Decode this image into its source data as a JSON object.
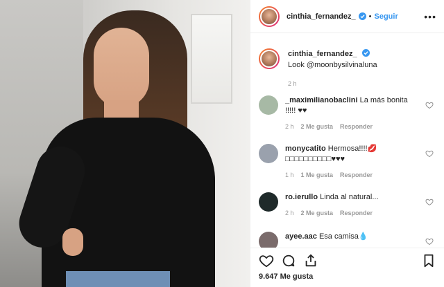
{
  "header": {
    "username": "cinthia_fernandez_",
    "follow_label": "Seguir",
    "separator": "•"
  },
  "caption": {
    "username": "cinthia_fernandez_",
    "text": "Look @moonbysilvinaluna",
    "mention": "@moonbysilvinaluna",
    "time": "2 h"
  },
  "comments": [
    {
      "username": "_maximilianobaclini",
      "text": "La más bonita !!!!! ♥♥",
      "time": "2 h",
      "likes": "2 Me gusta",
      "reply": "Responder",
      "avatar_color": "#a7b9a5"
    },
    {
      "username": "monycatito",
      "text": "Hermosa!!!!💋□□□□□□□□□□♥♥♥",
      "time": "1 h",
      "likes": "1 Me gusta",
      "reply": "Responder",
      "avatar_color": "#9aa1ad"
    },
    {
      "username": "ro.ierullo",
      "text": "Linda al natural...",
      "time": "2 h",
      "likes": "2 Me gusta",
      "reply": "Responder",
      "avatar_color": "#1f2a2a"
    },
    {
      "username": "ayee.aac",
      "text": "Esa camisa💧",
      "time": "",
      "likes": "",
      "reply": "",
      "avatar_color": "#7a6b6b"
    }
  ],
  "actions": {
    "likes_count": "9.647 Me gusta",
    "icons": [
      "heart-icon",
      "comment-icon",
      "share-icon",
      "bookmark-icon"
    ]
  },
  "colors": {
    "accent": "#3897f0",
    "text": "#262626",
    "muted": "#999999",
    "verified": "#3897f0"
  }
}
